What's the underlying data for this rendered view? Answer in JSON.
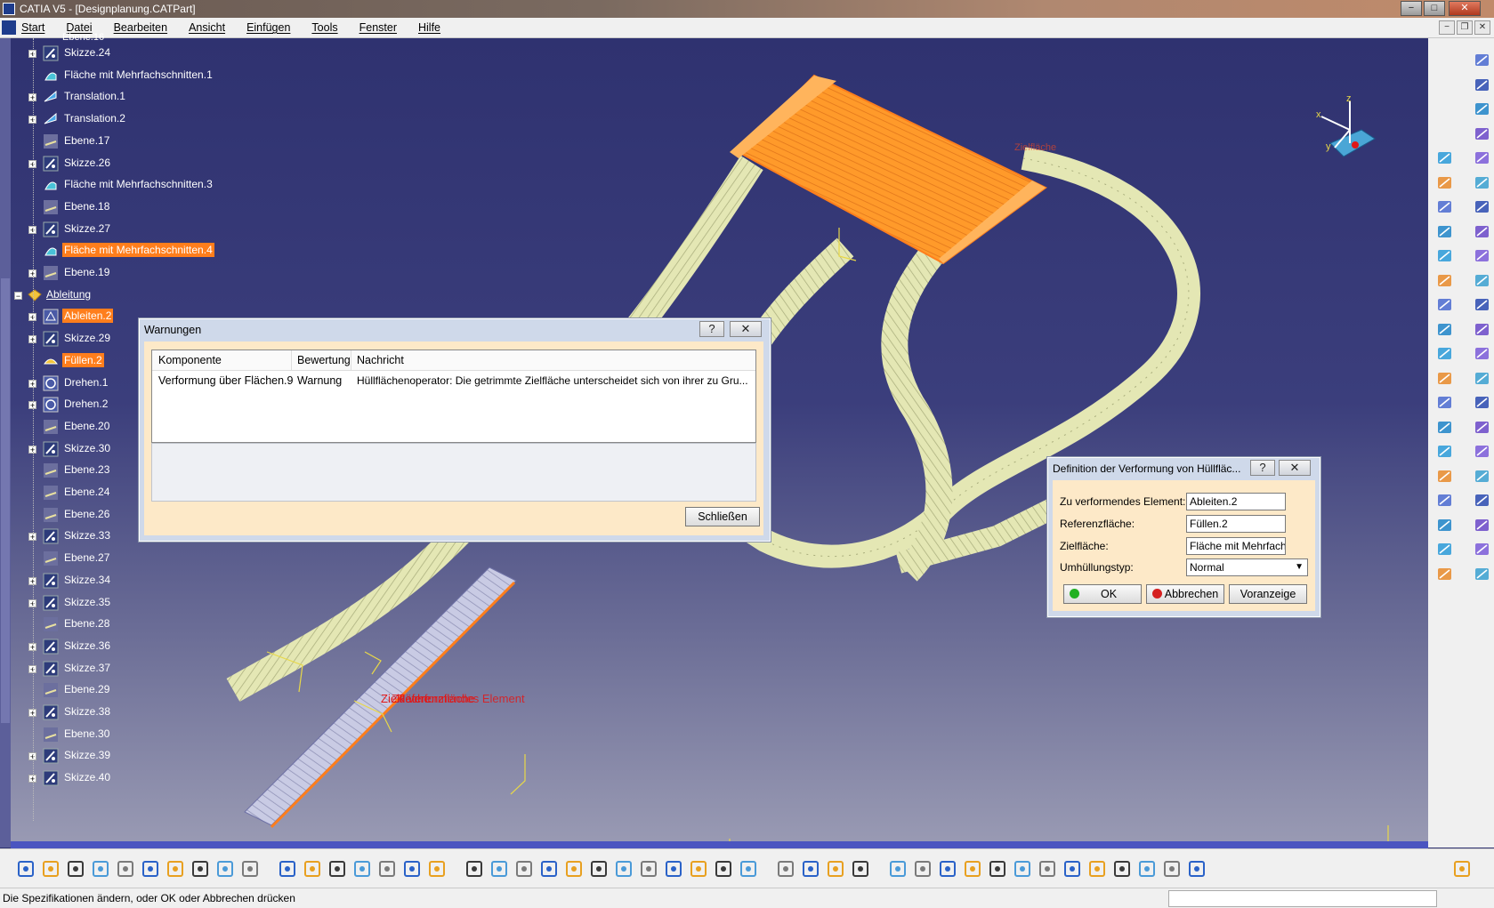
{
  "window": {
    "title": "CATIA V5 - [Designplanung.CATPart]",
    "min": "−",
    "max": "□",
    "close": "✕"
  },
  "menu": {
    "items": [
      "Start",
      "Datei",
      "Bearbeiten",
      "Ansicht",
      "Einfügen",
      "Tools",
      "Fenster",
      "Hilfe"
    ],
    "mdi": [
      "−",
      "❐",
      "✕"
    ]
  },
  "tree": {
    "top_partial": "Ebene.16",
    "nodes": [
      {
        "label": "Skizze.24",
        "icon": "sketch-icon",
        "selected": false
      },
      {
        "label": "Fläche mit Mehrfachschnitten.1",
        "icon": "multisection-surface-icon",
        "selected": false
      },
      {
        "label": "Translation.1",
        "icon": "translation-icon",
        "selected": false
      },
      {
        "label": "Translation.2",
        "icon": "translation-icon",
        "selected": false
      },
      {
        "label": "Ebene.17",
        "icon": "plane-icon",
        "selected": false
      },
      {
        "label": "Skizze.26",
        "icon": "sketch-icon",
        "selected": false
      },
      {
        "label": "Fläche mit Mehrfachschnitten.3",
        "icon": "multisection-surface-icon",
        "selected": false
      },
      {
        "label": "Ebene.18",
        "icon": "plane-icon",
        "selected": false
      },
      {
        "label": "Skizze.27",
        "icon": "sketch-icon",
        "selected": false
      },
      {
        "label": "Fläche mit Mehrfachschnitten.4",
        "icon": "multisection-surface-icon",
        "selected": true
      },
      {
        "label": "Ebene.19",
        "icon": "plane-icon",
        "selected": false
      }
    ],
    "set": {
      "label": "Ableitung",
      "icon": "geometrical-set-icon"
    },
    "children": [
      {
        "label": "Ableiten.2",
        "icon": "extract-icon",
        "selected": true
      },
      {
        "label": "Skizze.29",
        "icon": "sketch-icon",
        "selected": false
      },
      {
        "label": "Füllen.2",
        "icon": "fill-icon",
        "selected": true
      },
      {
        "label": "Drehen.1",
        "icon": "rotate-icon",
        "selected": false
      },
      {
        "label": "Drehen.2",
        "icon": "rotate-icon",
        "selected": false
      },
      {
        "label": "Ebene.20",
        "icon": "plane-icon",
        "selected": false
      },
      {
        "label": "Skizze.30",
        "icon": "sketch-icon",
        "selected": false
      },
      {
        "label": "Ebene.23",
        "icon": "plane-icon",
        "selected": false
      },
      {
        "label": "Ebene.24",
        "icon": "plane-icon",
        "selected": false
      },
      {
        "label": "Ebene.26",
        "icon": "plane-icon",
        "selected": false
      },
      {
        "label": "Skizze.33",
        "icon": "sketch-icon",
        "selected": false
      },
      {
        "label": "Ebene.27",
        "icon": "plane-icon",
        "selected": false
      },
      {
        "label": "Skizze.34",
        "icon": "sketch-icon",
        "selected": false
      },
      {
        "label": "Skizze.35",
        "icon": "sketch-icon",
        "selected": false
      },
      {
        "label": "Ebene.28",
        "icon": "plane-icon",
        "selected": false
      },
      {
        "label": "Skizze.36",
        "icon": "sketch-icon",
        "selected": false
      },
      {
        "label": "Skizze.37",
        "icon": "sketch-icon",
        "selected": false
      },
      {
        "label": "Ebene.29",
        "icon": "plane-icon",
        "selected": false
      },
      {
        "label": "Skizze.38",
        "icon": "sketch-icon",
        "selected": false
      },
      {
        "label": "Ebene.30",
        "icon": "plane-icon",
        "selected": false
      },
      {
        "label": "Skizze.39",
        "icon": "sketch-icon",
        "selected": false
      },
      {
        "label": "Skizze.40",
        "icon": "sketch-icon",
        "selected": false
      }
    ]
  },
  "viewport": {
    "labels": {
      "referenzflache": "Referenzfläche",
      "zielflache_overlap": "Zielfläche",
      "zu_verformendes": "Zu verformendes Element",
      "faint_label": "Zielfläche"
    },
    "axis": {
      "x": "x",
      "y": "y",
      "z": "z"
    }
  },
  "warnungen": {
    "title": "Warnungen",
    "help": "?",
    "close": "✕",
    "columns": [
      "Komponente",
      "Bewertung",
      "Nachricht"
    ],
    "rows": [
      {
        "komponente": "Verformung über Flächen.9",
        "bewertung": "Warnung",
        "nachricht": "Hüllflächenoperator: Die getrimmte Zielfläche unterscheidet sich von ihrer zu Gru..."
      }
    ],
    "close_button": "Schließen"
  },
  "definition": {
    "title": "Definition der Verformung von Hüllfläc...",
    "help": "?",
    "close": "✕",
    "fields": [
      {
        "label": "Zu verformendes Element:",
        "value": "Ableiten.2"
      },
      {
        "label": "Referenzfläche:",
        "value": "Füllen.2"
      },
      {
        "label": "Zielfläche:",
        "value": "Fläche mit Mehrfach"
      }
    ],
    "wrap_type": {
      "label": "Umhüllungstyp:",
      "value": "Normal"
    },
    "ok": "OK",
    "cancel": "Abbrechen",
    "preview": "Voranzeige"
  },
  "status": {
    "message": "Die Spezifikationen ändern, oder OK oder Abbrechen drücken"
  },
  "colors": {
    "selection": "#ff7e1c",
    "viewport_top": "#2f3270",
    "surface": "#e4e7b4",
    "orange_part": "#ff9a2a"
  }
}
